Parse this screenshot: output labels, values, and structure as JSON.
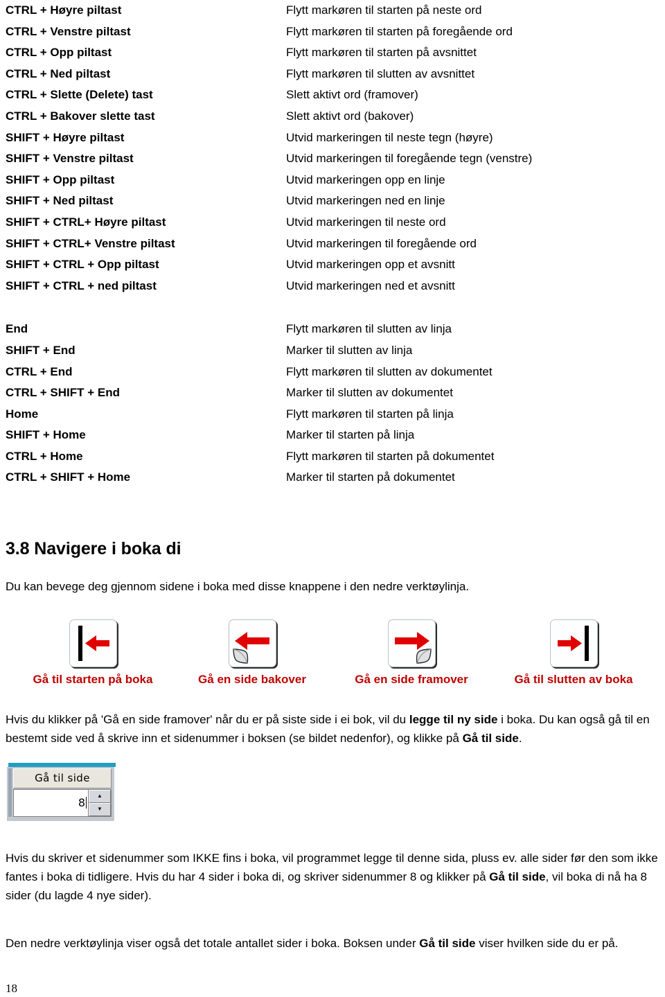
{
  "shortcut_blocks": [
    {
      "name": "arrow-key-shortcuts",
      "rows": [
        {
          "keys": "CTRL + Høyre piltast",
          "desc": "Flytt markøren til starten på neste ord"
        },
        {
          "keys": "CTRL + Venstre piltast",
          "desc": "Flytt markøren til starten på foregående ord"
        },
        {
          "keys": "CTRL + Opp piltast",
          "desc": "Flytt markøren til starten på avsnittet"
        },
        {
          "keys": "CTRL + Ned piltast",
          "desc": "Flytt markøren til slutten av avsnittet"
        },
        {
          "keys": "CTRL + Slette (Delete) tast",
          "desc": "Slett aktivt ord (framover)"
        },
        {
          "keys": "CTRL + Bakover slette tast",
          "desc": "Slett aktivt ord (bakover)"
        },
        {
          "keys": "SHIFT + Høyre piltast",
          "desc": "Utvid markeringen til neste tegn (høyre)"
        },
        {
          "keys": "SHIFT + Venstre piltast",
          "desc": "Utvid markeringen til foregående tegn (venstre)"
        },
        {
          "keys": "SHIFT + Opp piltast",
          "desc": "Utvid markeringen opp en linje"
        },
        {
          "keys": "SHIFT + Ned piltast",
          "desc": "Utvid markeringen ned en linje"
        },
        {
          "keys": "SHIFT + CTRL+ Høyre piltast",
          "desc": "Utvid markeringen til neste ord"
        },
        {
          "keys": "SHIFT + CTRL+ Venstre piltast",
          "desc": "Utvid markeringen til foregående ord"
        },
        {
          "keys": "SHIFT + CTRL + Opp piltast",
          "desc": "Utvid markeringen opp et avsnitt"
        },
        {
          "keys": "SHIFT + CTRL + ned piltast",
          "desc": "Utvid markeringen ned et avsnitt"
        }
      ]
    },
    {
      "name": "home-end-shortcuts",
      "rows": [
        {
          "keys": "End",
          "desc": "Flytt markøren til slutten av linja"
        },
        {
          "keys": "SHIFT + End",
          "desc": "Marker til slutten av linja"
        },
        {
          "keys": "CTRL + End",
          "desc": "Flytt markøren til slutten av dokumentet"
        },
        {
          "keys": "CTRL + SHIFT + End",
          "desc": "Marker til slutten av dokumentet"
        },
        {
          "keys": "Home",
          "desc": "Flytt markøren til starten på linja"
        },
        {
          "keys": "SHIFT + Home",
          "desc": "Marker til starten på linja"
        },
        {
          "keys": "CTRL + Home",
          "desc": "Flytt markøren til starten på dokumentet"
        },
        {
          "keys": "CTRL + SHIFT + Home",
          "desc": "Marker til starten på dokumentet"
        }
      ]
    }
  ],
  "section": {
    "heading": "3.8 Navigere i boka di",
    "intro": "Du kan bevege deg gjennom sidene i boka med disse knappene i den nedre verktøylinja."
  },
  "nav_buttons": [
    {
      "caption": "Gå til starten på boka",
      "icon": "first-page-icon"
    },
    {
      "caption": "Gå en side bakover",
      "icon": "previous-page-icon"
    },
    {
      "caption": "Gå en side framover",
      "icon": "next-page-icon"
    },
    {
      "caption": "Gå til slutten av boka",
      "icon": "last-page-icon"
    }
  ],
  "paragraph_after_buttons": {
    "part1": "Hvis du klikker på 'Gå en side framover' når du er på siste side i ei bok, vil du ",
    "bold1": "legge til ny side",
    "part2": " i boka. Du kan også gå til en bestemt side ved å skrive inn et sidenummer i boksen (se bildet nedenfor), og klikke på ",
    "bold2": "Gå til side",
    "part3": "."
  },
  "goto_widget": {
    "button_label": "Gå til side",
    "input_value": "8",
    "spin_up": "▲",
    "spin_down": "▼"
  },
  "paragraph_warning": {
    "part1": "Hvis du skriver et sidenummer som IKKE fins i boka, vil programmet legge til denne sida, pluss ev. alle sider før den som ikke fantes i boka di tidligere. Hvis du har 4 sider i boka di, og skriver sidenummer 8 og klikker på ",
    "bold1": "Gå til side",
    "part2": ", vil boka di nå ha 8 sider (du lagde 4 nye sider)."
  },
  "paragraph_final": {
    "part1": "Den nedre verktøylinja viser også det totale antallet sider i boka. Boksen under ",
    "bold1": "Gå til side",
    "part2": " viser hvilken side du er på."
  },
  "page_number": "18",
  "colors": {
    "caption_red": "#c00000",
    "arrow_red": "#e00000",
    "widget_topbar": "#1f9fc4",
    "widget_face": "#e8e6dd",
    "text": "#000000"
  }
}
